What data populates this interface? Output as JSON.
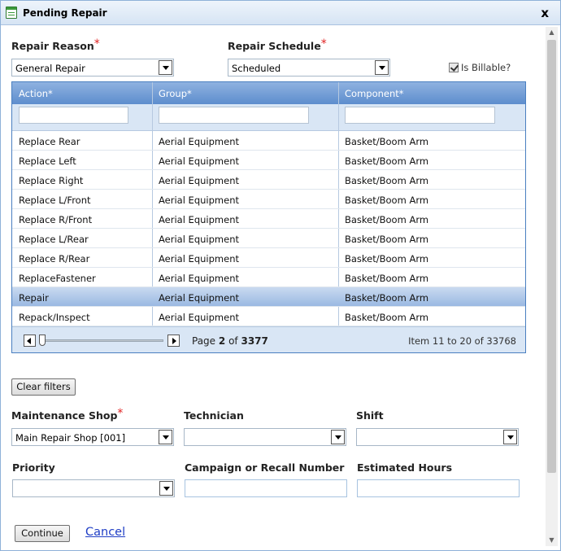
{
  "window": {
    "title": "Pending Repair",
    "close": "x"
  },
  "repair_reason": {
    "label": "Repair Reason",
    "required": "*",
    "value": "General Repair"
  },
  "repair_schedule": {
    "label": "Repair Schedule",
    "required": "*",
    "value": "Scheduled"
  },
  "billable": {
    "label": "Is Billable?",
    "checked": true
  },
  "grid": {
    "columns": [
      "Action*",
      "Group*",
      "Component*"
    ],
    "rows": [
      {
        "action": "Replace Rear",
        "group": "Aerial Equipment",
        "component": "Basket/Boom Arm"
      },
      {
        "action": "Replace Left",
        "group": "Aerial Equipment",
        "component": "Basket/Boom Arm"
      },
      {
        "action": "Replace Right",
        "group": "Aerial Equipment",
        "component": "Basket/Boom Arm"
      },
      {
        "action": "Replace L/Front",
        "group": "Aerial Equipment",
        "component": "Basket/Boom Arm"
      },
      {
        "action": "Replace R/Front",
        "group": "Aerial Equipment",
        "component": "Basket/Boom Arm"
      },
      {
        "action": "Replace L/Rear",
        "group": "Aerial Equipment",
        "component": "Basket/Boom Arm"
      },
      {
        "action": "Replace R/Rear",
        "group": "Aerial Equipment",
        "component": "Basket/Boom Arm"
      },
      {
        "action": "ReplaceFastener",
        "group": "Aerial Equipment",
        "component": "Basket/Boom Arm"
      },
      {
        "action": "Repair",
        "group": "Aerial Equipment",
        "component": "Basket/Boom Arm"
      },
      {
        "action": "Repack/Inspect",
        "group": "Aerial Equipment",
        "component": "Basket/Boom Arm"
      }
    ],
    "selected_row": 8,
    "pager": {
      "page_label": "Page",
      "page": "2",
      "of_label": "of",
      "total_pages": "3377",
      "items": "Item 11 to 20 of 33768"
    }
  },
  "clear_filters": "Clear filters",
  "maintenance_shop": {
    "label": "Maintenance Shop",
    "required": "*",
    "value": "Main Repair Shop [001]"
  },
  "technician": {
    "label": "Technician",
    "value": ""
  },
  "shift": {
    "label": "Shift",
    "value": ""
  },
  "priority": {
    "label": "Priority",
    "value": ""
  },
  "campaign": {
    "label": "Campaign or Recall Number",
    "value": ""
  },
  "estimated_hours": {
    "label": "Estimated Hours",
    "value": ""
  },
  "buttons": {
    "continue": "Continue",
    "cancel": "Cancel"
  },
  "colors": {
    "header": "#5d8dcd",
    "filter_row": "#d9e6f5",
    "required": "#e02020",
    "link": "#1f3ec5"
  }
}
